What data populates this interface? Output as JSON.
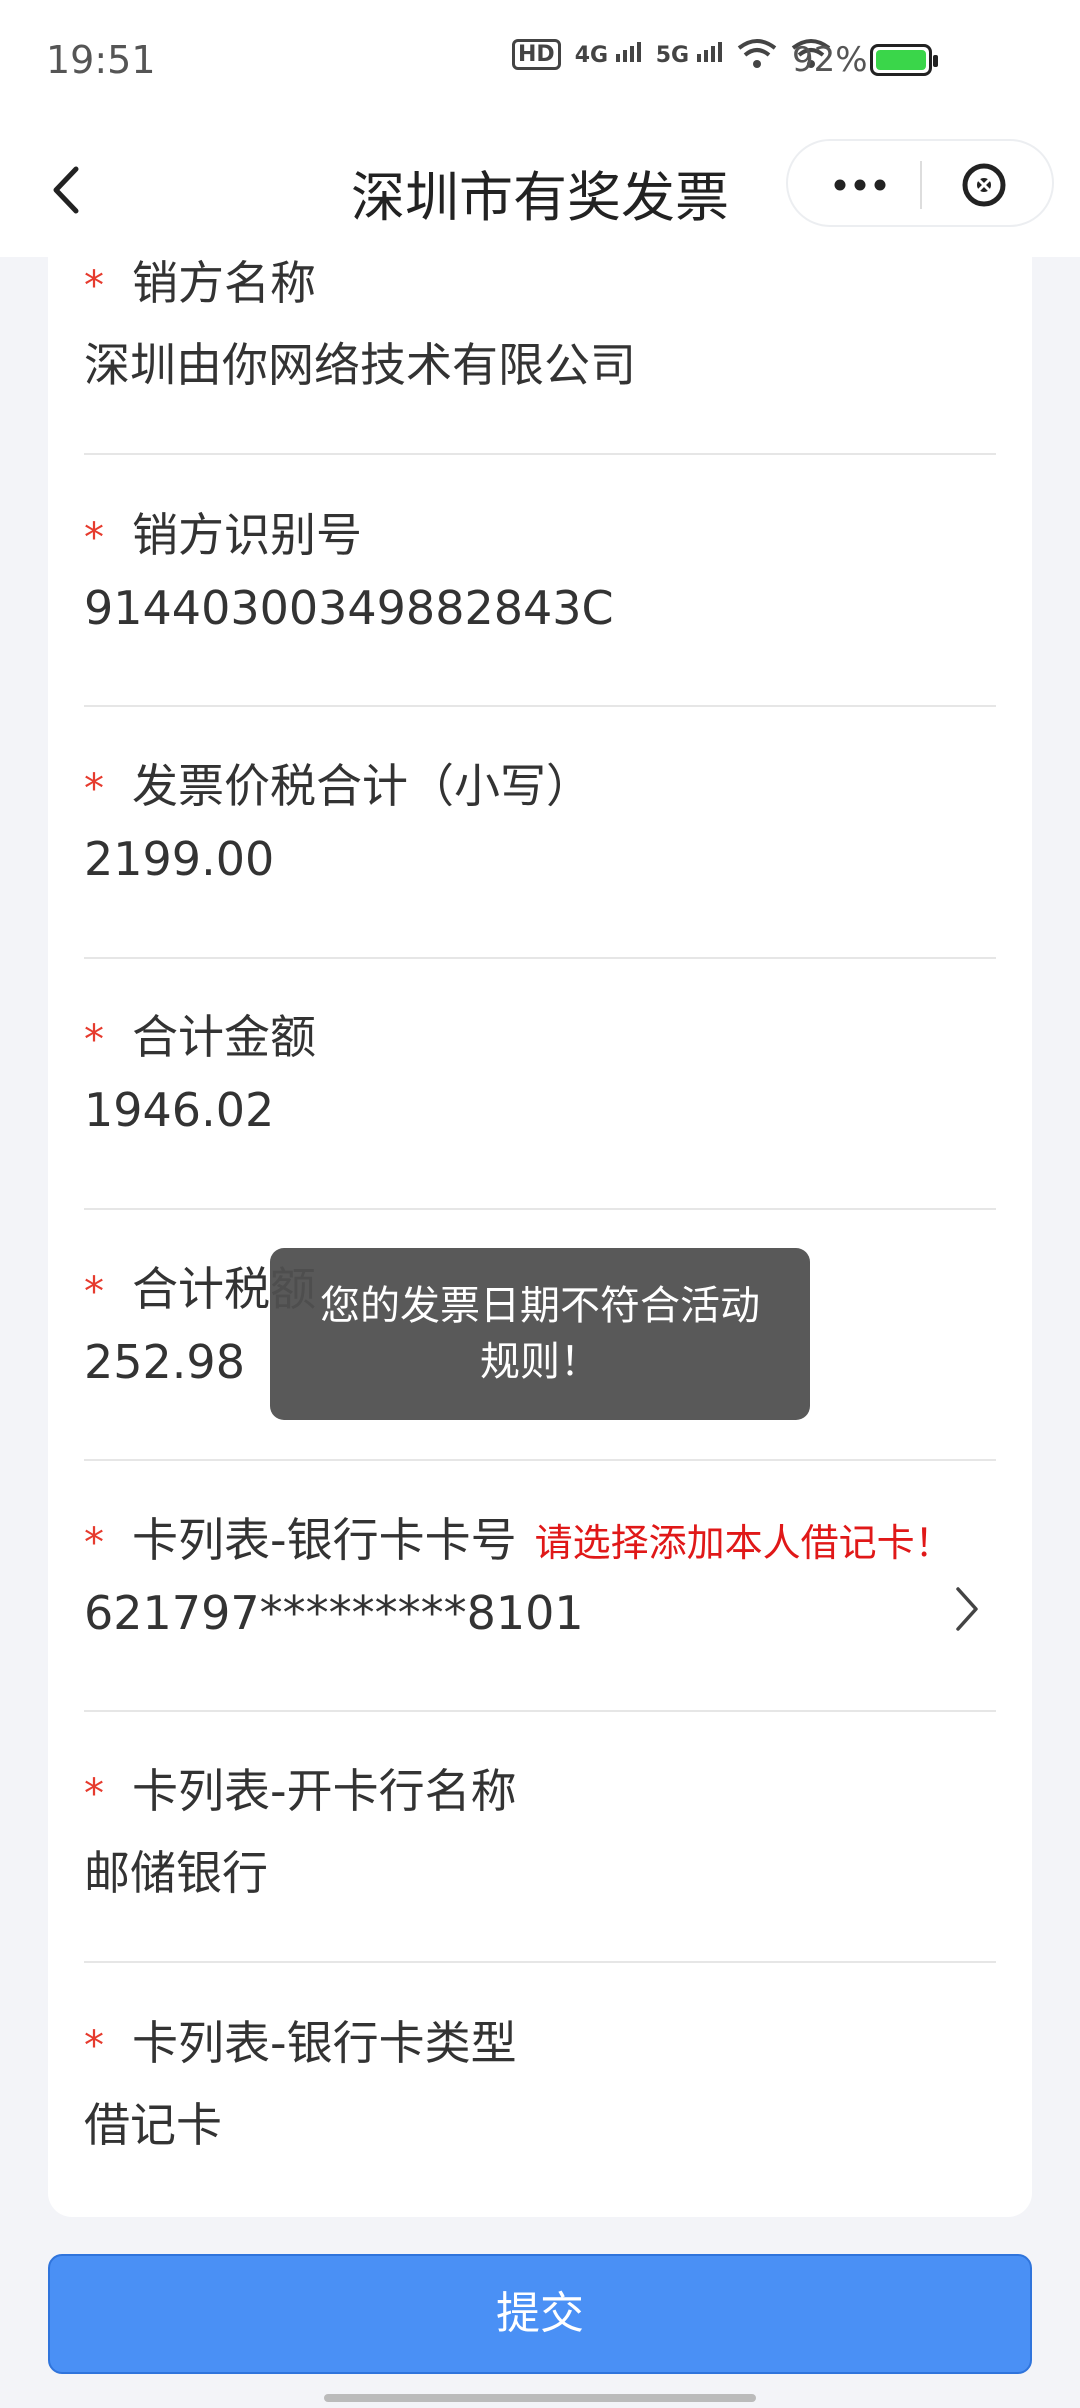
{
  "status": {
    "time": "19:51",
    "hd": "HD",
    "net1": "4G",
    "net2": "5G",
    "battery_pct": "92%"
  },
  "nav": {
    "title": "深圳市有奖发票"
  },
  "fields": [
    {
      "label": "销方名称",
      "value": "深圳由你网络技术有限公司"
    },
    {
      "label": "销方识别号",
      "value": "91440300349882843C"
    },
    {
      "label": "发票价税合计（小写）",
      "value": "2199.00"
    },
    {
      "label": "合计金额",
      "value": "1946.02"
    },
    {
      "label": "合计税额",
      "value": "252.98"
    },
    {
      "label": "卡列表-银行卡卡号",
      "hint": "请选择添加本人借记卡！",
      "value": "621797*********8101"
    },
    {
      "label": "卡列表-开卡行名称",
      "value": "邮储银行"
    },
    {
      "label": "卡列表-银行卡类型",
      "value": "借记卡"
    }
  ],
  "toast": {
    "message": "您的发票日期不符合活动规则！"
  },
  "submit_label": "提交",
  "colors": {
    "accent": "#4a90f5",
    "required": "#e63b2e",
    "battery": "#3ad64a"
  }
}
